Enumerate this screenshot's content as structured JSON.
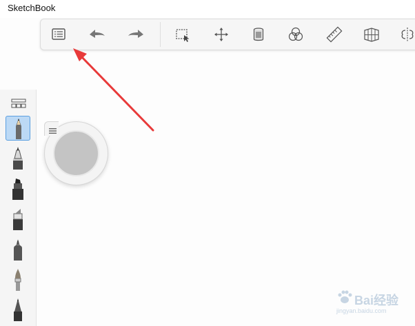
{
  "window": {
    "title": "SketchBook"
  },
  "toolbar": {
    "items": [
      {
        "icon": "list-icon"
      },
      {
        "icon": "undo-icon"
      },
      {
        "icon": "redo-icon"
      },
      {
        "icon": "selection-icon"
      },
      {
        "icon": "transform-icon"
      },
      {
        "icon": "layer-icon"
      },
      {
        "icon": "color-circles-icon"
      },
      {
        "icon": "ruler-icon"
      },
      {
        "icon": "perspective-icon"
      },
      {
        "icon": "symmetry-icon"
      }
    ]
  },
  "brush_panel": {
    "grid_icon": "brush-library-icon",
    "brushes": [
      {
        "icon": "pencil-icon",
        "selected": true
      },
      {
        "icon": "ballpoint-pen-icon",
        "selected": false
      },
      {
        "icon": "marker-icon",
        "selected": false
      },
      {
        "icon": "chisel-marker-icon",
        "selected": false
      },
      {
        "icon": "fineliner-icon",
        "selected": false
      },
      {
        "icon": "paintbrush-icon",
        "selected": false
      },
      {
        "icon": "ink-pen-icon",
        "selected": false
      }
    ]
  },
  "color_puck": {
    "color": "#c4c4c4"
  },
  "annotation": {
    "color": "#e83a3a"
  },
  "watermark": {
    "text": "Bai经验",
    "url": "jingyan.baidu.com"
  }
}
